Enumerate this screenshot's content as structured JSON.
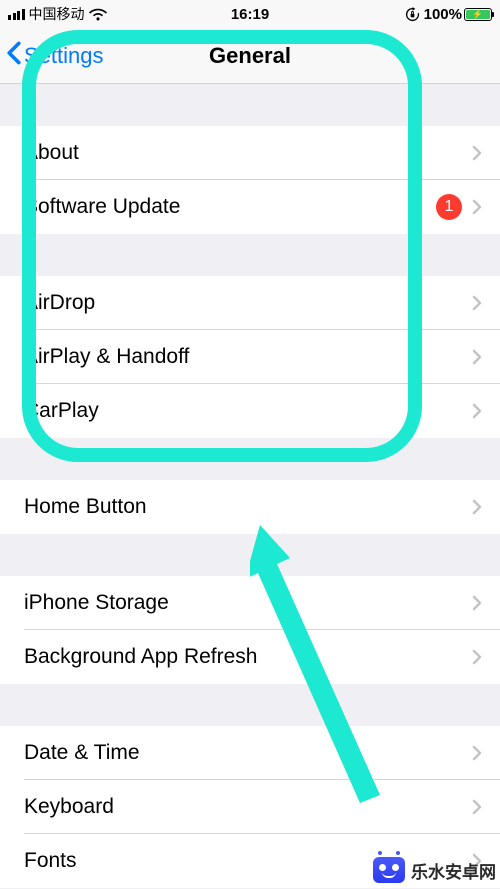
{
  "status": {
    "carrier": "中国移动",
    "time": "16:19",
    "battery_pct": "100%"
  },
  "nav": {
    "back_label": "Settings",
    "title": "General"
  },
  "groups": [
    {
      "rows": [
        {
          "label": "About",
          "badge": null
        },
        {
          "label": "Software Update",
          "badge": "1"
        }
      ]
    },
    {
      "rows": [
        {
          "label": "AirDrop",
          "badge": null
        },
        {
          "label": "AirPlay & Handoff",
          "badge": null
        },
        {
          "label": "CarPlay",
          "badge": null
        }
      ]
    },
    {
      "rows": [
        {
          "label": "Home Button",
          "badge": null
        }
      ]
    },
    {
      "rows": [
        {
          "label": "iPhone Storage",
          "badge": null
        },
        {
          "label": "Background App Refresh",
          "badge": null
        }
      ]
    },
    {
      "rows": [
        {
          "label": "Date & Time",
          "badge": null
        },
        {
          "label": "Keyboard",
          "badge": null
        },
        {
          "label": "Fonts",
          "badge": null
        }
      ]
    }
  ],
  "watermark": {
    "text": "乐水安卓网"
  },
  "annotation": {
    "color": "#1de8d2"
  }
}
